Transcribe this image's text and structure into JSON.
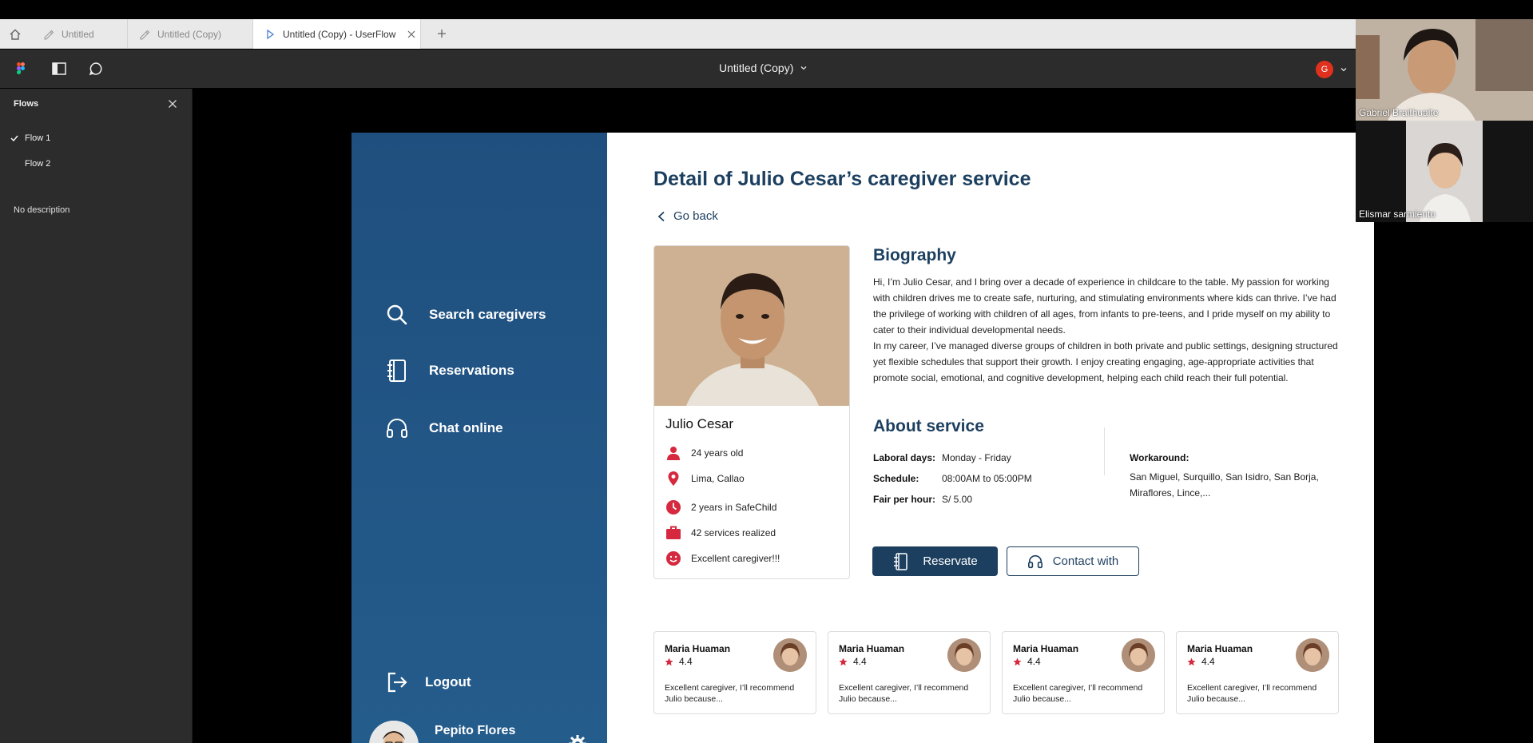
{
  "browser": {
    "tabs": [
      {
        "label": "Untitled"
      },
      {
        "label": "Untitled (Copy)"
      },
      {
        "label": "Untitled (Copy) - UserFlow"
      }
    ]
  },
  "toolbar": {
    "doc_title": "Untitled (Copy)",
    "avatar_letter": "G"
  },
  "flows_panel": {
    "title": "Flows",
    "items": [
      {
        "label": "Flow 1",
        "selected": true
      },
      {
        "label": "Flow 2",
        "selected": false
      }
    ],
    "description": "No description"
  },
  "app": {
    "nav": [
      {
        "label": "Search caregivers",
        "icon": "search-icon"
      },
      {
        "label": "Reservations",
        "icon": "notebook-icon"
      },
      {
        "label": "Chat online",
        "icon": "headset-icon"
      }
    ],
    "logout_label": "Logout",
    "user_name": "Pepito Flores",
    "sidebar_color": "#1f4f7e",
    "accent_color": "#1c3f5f",
    "icon_color": "#d6283e"
  },
  "page": {
    "title": "Detail of Julio Cesar’s caregiver service",
    "go_back": "Go back",
    "profile": {
      "name": "Julio Cesar",
      "details": [
        {
          "icon": "person-icon",
          "text": "24 years old"
        },
        {
          "icon": "location-pin-icon",
          "text": "Lima, Callao"
        },
        {
          "icon": "clock-icon",
          "text": "2 years in SafeChild"
        },
        {
          "icon": "briefcase-icon",
          "text": "42 services realized"
        },
        {
          "icon": "smiley-icon",
          "text": "Excellent caregiver!!!"
        }
      ]
    },
    "biography": {
      "title": "Biography",
      "paragraphs": [
        "Hi, I’m Julio Cesar, and I bring over a decade of experience in childcare to the table. My passion for working with children drives me to create safe, nurturing, and stimulating environments where kids can thrive. I’ve had the privilege of working with children of all ages, from infants to pre-teens, and I pride myself on my ability to cater to their individual developmental needs.",
        "In my career, I’ve managed diverse groups of children in both private and public settings, designing structured yet flexible schedules that support their growth. I enjoy creating engaging, age-appropriate activities that promote social, emotional, and cognitive development, helping each child reach their full potential."
      ]
    },
    "about": {
      "title": "About service",
      "laboral_label": "Laboral days:",
      "laboral_value": "Monday - Friday",
      "schedule_label": "Schedule:",
      "schedule_value": "08:00AM to 05:00PM",
      "fair_label": "Fair per hour:",
      "fair_value": "S/ 5.00",
      "workaround_label": "Workaround:",
      "workaround_value": "San Miguel, Surquillo, San Isidro, San Borja, Miraflores, Lince,..."
    },
    "buttons": {
      "reserve": "Reservate",
      "contact": "Contact with"
    },
    "reviews": [
      {
        "name": "Maria Huaman",
        "rating": "4.4",
        "text": "Excellent caregiver, I’ll recommend Julio because..."
      },
      {
        "name": "Maria Huaman",
        "rating": "4.4",
        "text": "Excellent caregiver, I’ll recommend Julio because..."
      },
      {
        "name": "Maria Huaman",
        "rating": "4.4",
        "text": "Excellent caregiver, I’ll recommend Julio because..."
      },
      {
        "name": "Maria Huaman",
        "rating": "4.4",
        "text": "Excellent caregiver, I’ll recommend Julio because..."
      }
    ]
  },
  "video_call": {
    "participants": [
      {
        "name": "Gabriel Braithuaite"
      },
      {
        "name": "Elismar sarmiento"
      }
    ]
  }
}
